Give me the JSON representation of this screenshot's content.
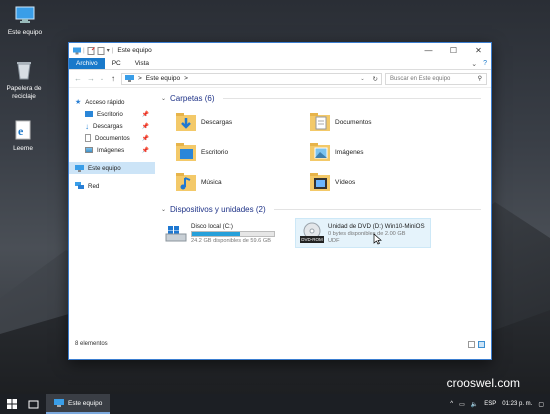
{
  "desktop": {
    "icons": [
      {
        "label": "Este equipo",
        "icon": "computer-icon"
      },
      {
        "label": "Papelera de reciclaje",
        "icon": "recycle-bin-icon"
      },
      {
        "label": "Leeme",
        "icon": "ie-document-icon"
      }
    ],
    "watermark": "crooswel.com"
  },
  "window": {
    "title": "Este equipo",
    "tabs": [
      "Archivo",
      "PC",
      "Vista"
    ],
    "address": {
      "root_symbol": ">",
      "location": "Este equipo",
      "trail_symbol": ">"
    },
    "search_placeholder": "Buscar en Este equipo",
    "nav_pane": {
      "quick_access": "Acceso rápido",
      "quick_items": [
        "Escritorio",
        "Descargas",
        "Documentos",
        "Imágenes"
      ],
      "this_pc": "Este equipo",
      "network": "Red"
    },
    "folders_header": "Carpetas (6)",
    "folders": [
      {
        "name": "Descargas",
        "icon": "download-folder-icon"
      },
      {
        "name": "Documentos",
        "icon": "documents-folder-icon"
      },
      {
        "name": "Escritorio",
        "icon": "desktop-folder-icon"
      },
      {
        "name": "Imágenes",
        "icon": "pictures-folder-icon"
      },
      {
        "name": "Música",
        "icon": "music-folder-icon"
      },
      {
        "name": "Vídeos",
        "icon": "videos-folder-icon"
      }
    ],
    "devices_header": "Dispositivos y unidades (2)",
    "drives": [
      {
        "name": "Disco local (C:)",
        "space": "24.2 GB disponibles de 59.6 GB",
        "used_fraction": 0.59
      },
      {
        "name": "Unidad de DVD (D:) Win10-MiniOS",
        "space": "0 bytes disponibles de 2.00 GB",
        "fs": "UDF",
        "badge": "DVD-ROM"
      }
    ],
    "status": "8 elementos"
  },
  "taskbar": {
    "app": "Este equipo",
    "language": "ESP",
    "time": "01:23 p. m."
  },
  "colors": {
    "accent": "#1979ca",
    "group_header": "#1e3287",
    "selection": "#cce4f7"
  }
}
